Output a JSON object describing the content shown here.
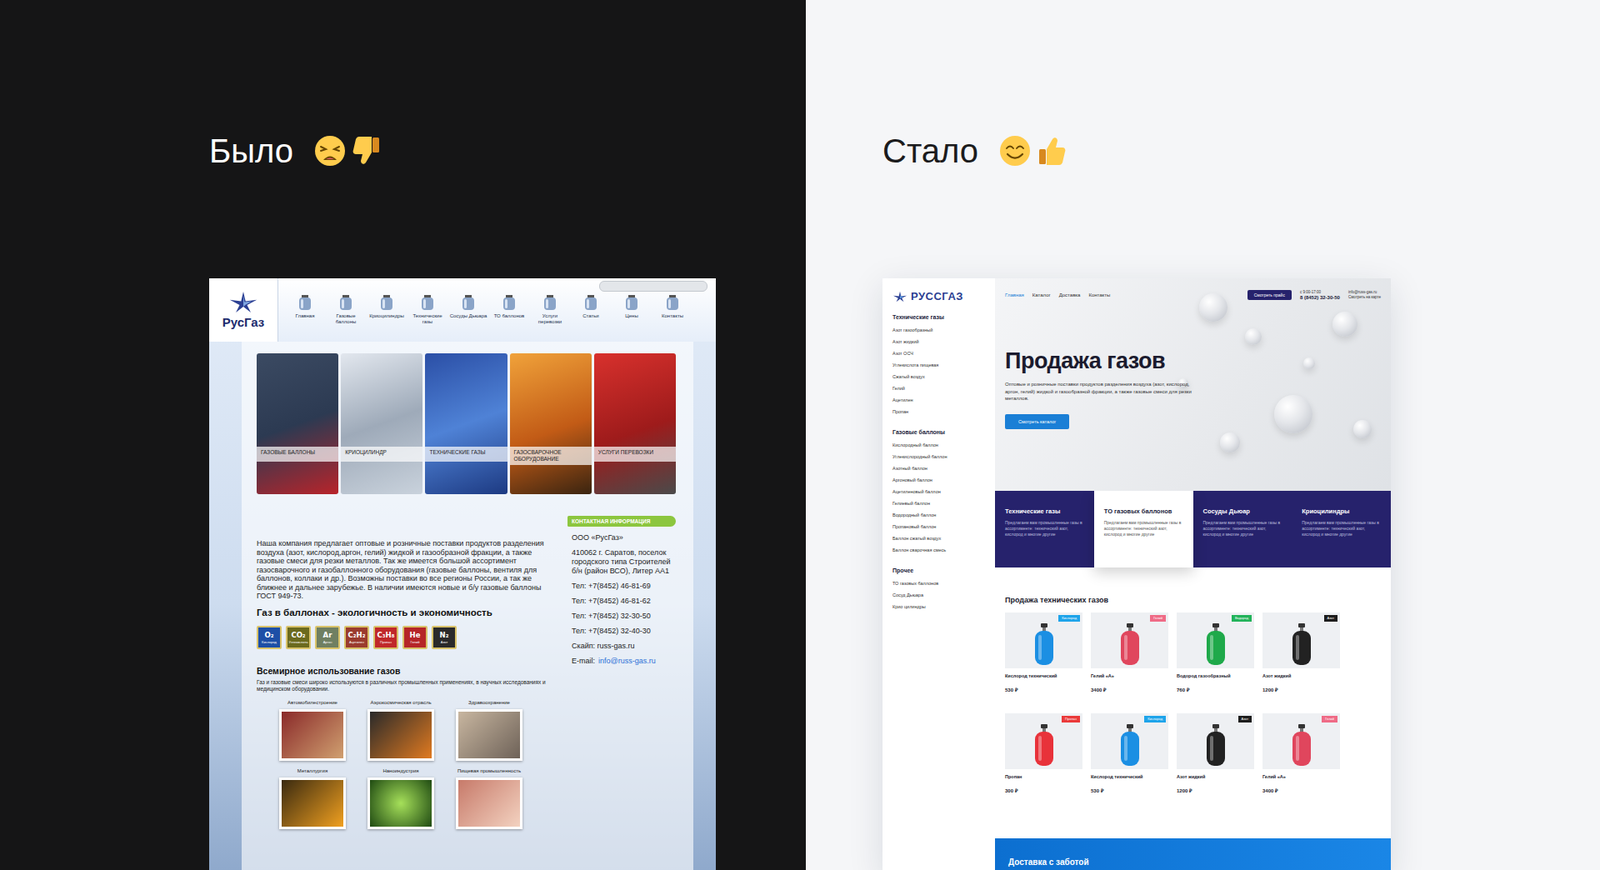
{
  "panels": [
    {
      "heading": "Было",
      "kind": "bad"
    },
    {
      "heading": "Стало",
      "kind": "good"
    }
  ],
  "old_site": {
    "logo": "РусГаз",
    "nav": [
      "Главная",
      "Газовые баллоны",
      "Криоцилиндры",
      "Технические газы",
      "Сосуды Дьюара",
      "ТО баллонов",
      "Услуги перевозки",
      "Статьи",
      "Цены",
      "Контакты"
    ],
    "tiles": [
      "ГАЗОВЫЕ БАЛЛОНЫ",
      "КРИОЦИЛИНДР",
      "ТЕХНИЧЕСКИЕ ГАЗЫ",
      "ГАЗОСВАРОЧНОЕ ОБОРУДОВАНИЕ",
      "УСЛУГИ ПЕРЕВОЗКИ"
    ],
    "intro": "Наша компания предлагает оптовые и розничные поставки продуктов разделения воздуха (азот, кислород,аргон, гелий) жидкой и газообразной фракции, а также газовые смеси для резки металлов. Так же имеется большой ассортимент газосварочного и газобаллонного оборудования (газовые баллоны, вентиля для баллонов, коллаки и др.). Возможны поставки во все регионы России, а так же ближнее и дальнее зарубежье. В наличии имеются новые и б/у газовые баллоны ГОСТ 949-73.",
    "eco_heading": "Газ в баллонах - экологичность и экономичность",
    "gases": [
      {
        "symbol": "O₂",
        "name": "Кислород",
        "color": "#1d4fa6"
      },
      {
        "symbol": "CO₂",
        "name": "Углекислота",
        "color": "#6b6a1e"
      },
      {
        "symbol": "Ar",
        "name": "Аргон",
        "color": "#6f7f62"
      },
      {
        "symbol": "C₂H₂",
        "name": "Ацетилен",
        "color": "#9a3b2e"
      },
      {
        "symbol": "C₃H₈",
        "name": "Пропан",
        "color": "#c0282a"
      },
      {
        "symbol": "He",
        "name": "Гелий",
        "color": "#b52528"
      },
      {
        "symbol": "N₂",
        "name": "Азот",
        "color": "#2a2a2a"
      }
    ],
    "usage_heading": "Всемирное использование газов",
    "usage_text": "Газ и газовые смеси широко используются в различных промышленных применениях, в научных исследованиях и медицинском оборудовании.",
    "usages": [
      "Автомобилестроение",
      "Аэрокосмическая отрасль",
      "Здравоохранение",
      "Металлургия",
      "Наноиндустрия",
      "Пищевая промышленность"
    ],
    "contacts": {
      "header": "КОНТАКТНАЯ ИНФОРМАЦИЯ",
      "company": "ООО «РусГаз»",
      "address": "410062 г. Саратов, поселок городского типа Строителей б/н (район ВСО), Литер АА1",
      "phones": [
        "Тел: +7(8452) 46-81-69",
        "Тел: +7(8452) 46-81-62",
        "Тел: +7(8452) 32-30-50",
        "Тел: +7(8452) 32-40-30"
      ],
      "skype": "Скайп: russ-gas.ru",
      "email_label": "E-mail:",
      "email": "info@russ-gas.ru"
    }
  },
  "new_site": {
    "logo": "РУССГАЗ",
    "nav": [
      {
        "label": "Главная",
        "selected": true
      },
      {
        "label": "Каталог",
        "selected": false
      },
      {
        "label": "Доставка",
        "selected": false
      },
      {
        "label": "Контакты",
        "selected": false
      }
    ],
    "price_button": "Смотреть прайс",
    "hours": "с 9:00-17:00",
    "phone": "8 (8452) 32-30-50",
    "email": "info@russ-gas.ru",
    "map_link": "Смотреть на карте",
    "sidebar": [
      {
        "title": "Технические газы",
        "items": [
          "Азот газообразный",
          "Азот жидкий",
          "Азот ОСЧ",
          "Углекислота пищевая",
          "Сжатый воздух",
          "Гелий",
          "Ацетилен",
          "Пропан"
        ]
      },
      {
        "title": "Газовые баллоны",
        "items": [
          "Кислородный баллон",
          "Углекислородный баллон",
          "Азотный баллон",
          "Аргоновый баллон",
          "Ацетиленовый баллон",
          "Гелиевый баллон",
          "Водородный баллон",
          "Пропановый баллон",
          "Баллон сжатый воздух",
          "Баллон сварочная смесь"
        ]
      },
      {
        "title": "Прочее",
        "items": [
          "ТО газовых баллонов",
          "Сосуд Дьюара",
          "Крио цилиндры"
        ]
      }
    ],
    "hero": {
      "title": "Продажа газов",
      "text": "Оптовые и розничные поставки продуктов разделения воздуха (азот, кислород, аргон, гелий) жидкой и газообразной фракции, а также газовые смеси для резки металлов.",
      "button": "Смотреть каталог"
    },
    "categories": [
      {
        "title": "Технические газы",
        "text": "Предлагаем вам промышленные газы в ассортименте: технический азот, кислород и многие другие",
        "selected": false
      },
      {
        "title": "ТО газовых баллонов",
        "text": "Предлагаем вам промышленные газы в ассортименте: технический азот, кислород и многие другие",
        "selected": true
      },
      {
        "title": "Сосуды Дьюар",
        "text": "Предлагаем вам промышленные газы в ассортименте: технический азот, кислород и многие другие",
        "selected": false
      },
      {
        "title": "Криоцилиндры",
        "text": "Предлагаем вам промышленные газы в ассортименте: технический азот, кислород и многие другие",
        "selected": false
      }
    ],
    "products_heading": "Продажа технических газов",
    "products": [
      {
        "name": "Кислород технический",
        "price": "530 ₽",
        "badge": "Кислород",
        "badge_color": "#1ea4ea",
        "color": "#1b8fe3"
      },
      {
        "name": "Гелий «А»",
        "price": "3400 ₽",
        "badge": "Гелий",
        "badge_color": "#ef6b86",
        "color": "#e0465d"
      },
      {
        "name": "Водород газообразный",
        "price": "760 ₽",
        "badge": "Водород",
        "badge_color": "#22b35a",
        "color": "#1fa94a"
      },
      {
        "name": "Азот жидкий",
        "price": "1200 ₽",
        "badge": "Азот",
        "badge_color": "#1d1d1d",
        "color": "#222222"
      },
      {
        "name": "Пропан",
        "price": "300 ₽",
        "badge": "Пропан",
        "badge_color": "#ea3a3a",
        "color": "#e8323a"
      },
      {
        "name": "Кислород технический",
        "price": "530 ₽",
        "badge": "Кислород",
        "badge_color": "#1ea4ea",
        "color": "#1b8fe3"
      },
      {
        "name": "Азот жидкий",
        "price": "1200 ₽",
        "badge": "Азот",
        "badge_color": "#1d1d1d",
        "color": "#222222"
      },
      {
        "name": "Гелий «А»",
        "price": "3400 ₽",
        "badge": "Гелий",
        "badge_color": "#ef6b86",
        "color": "#e0465d"
      }
    ],
    "banner": {
      "title": "Доставка с заботой"
    }
  }
}
